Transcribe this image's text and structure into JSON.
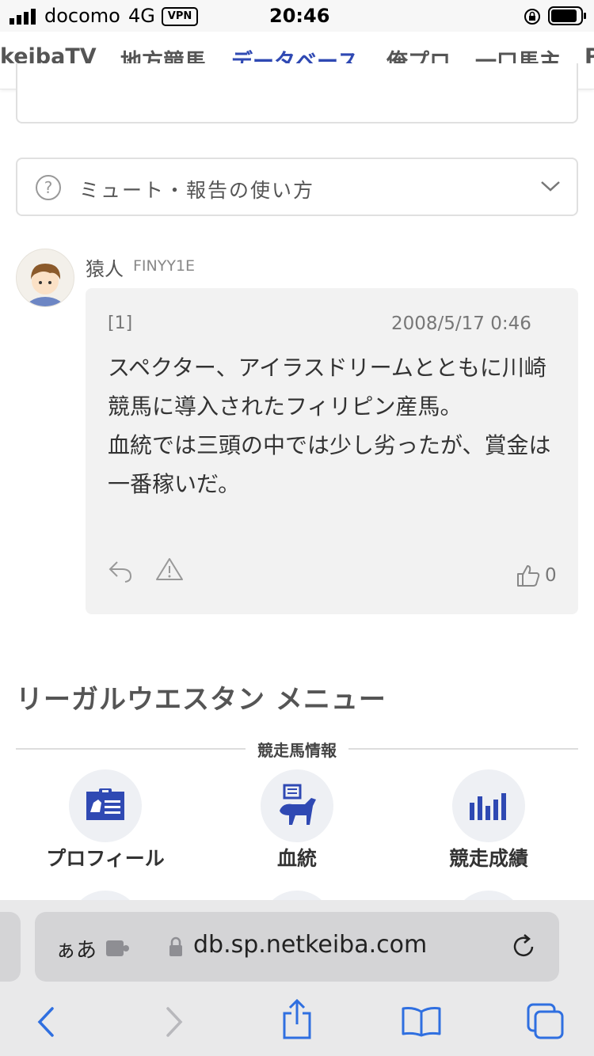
{
  "status_bar": {
    "carrier": "docomo",
    "network": "4G",
    "vpn": "VPN",
    "time": "20:46"
  },
  "nav": {
    "tabs": [
      "keibaTV",
      "地方競馬",
      "データベース",
      "俺プロ",
      "一口馬主",
      "P"
    ]
  },
  "help": {
    "label": "ミュート・報告の使い方"
  },
  "comment": {
    "username": "猿人",
    "user_id": "FINYY1E",
    "number": "[1]",
    "date": "2008/5/17 0:46",
    "text": "スペクター、アイラスドリームとともに川崎競馬に導入されたフィリピン産馬。\n血統では三頭の中では少し劣ったが、賞金は一番稼いだ。",
    "likes": "0"
  },
  "menu": {
    "title": "リーガルウエスタン メニュー",
    "section": "競走馬情報",
    "items": [
      "プロフィール",
      "血統",
      "競走成績"
    ]
  },
  "browser": {
    "aa": "ぁあ",
    "url": "db.sp.netkeiba.com"
  },
  "colors": {
    "accent": "#2f49b3",
    "ios_blue": "#2f6fe0"
  }
}
